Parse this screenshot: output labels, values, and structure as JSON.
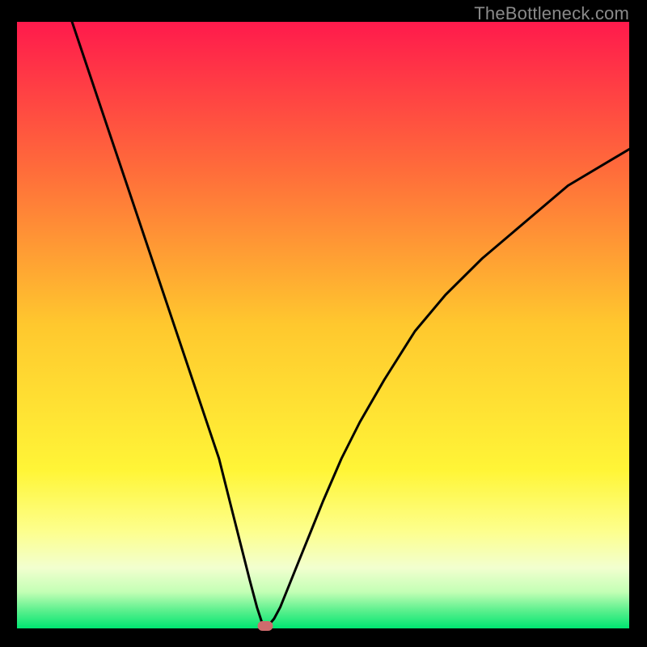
{
  "watermark": "TheBottleneck.com",
  "chart_data": {
    "type": "line",
    "title": "",
    "xlabel": "",
    "ylabel": "",
    "xlim": [
      0,
      100
    ],
    "ylim": [
      0,
      100
    ],
    "grid": false,
    "legend": false,
    "series": [
      {
        "name": "bottleneck-curve",
        "x": [
          9,
          12,
          15,
          18,
          21,
          24,
          27,
          30,
          33,
          35,
          36.5,
          38,
          39.2,
          40,
          40.5,
          41,
          42,
          43,
          44,
          46,
          48,
          50,
          53,
          56,
          60,
          65,
          70,
          76,
          83,
          90,
          100
        ],
        "y": [
          100,
          91,
          82,
          73,
          64,
          55,
          46,
          37,
          28,
          20,
          14,
          8,
          3.5,
          1,
          0.4,
          0.4,
          1.6,
          3.5,
          6,
          11,
          16,
          21,
          28,
          34,
          41,
          49,
          55,
          61,
          67,
          73,
          79
        ]
      }
    ],
    "marker": {
      "x": 40.6,
      "y": 0.4,
      "color": "#cf6b6d"
    },
    "background_gradient": [
      {
        "pct": 0,
        "color": "#ff1a4c"
      },
      {
        "pct": 25,
        "color": "#ff6e3a"
      },
      {
        "pct": 50,
        "color": "#ffc82e"
      },
      {
        "pct": 74,
        "color": "#fff537"
      },
      {
        "pct": 84,
        "color": "#fdff8d"
      },
      {
        "pct": 90,
        "color": "#f2ffcf"
      },
      {
        "pct": 94,
        "color": "#c3ffb5"
      },
      {
        "pct": 97,
        "color": "#5df08e"
      },
      {
        "pct": 100,
        "color": "#00e571"
      }
    ]
  }
}
